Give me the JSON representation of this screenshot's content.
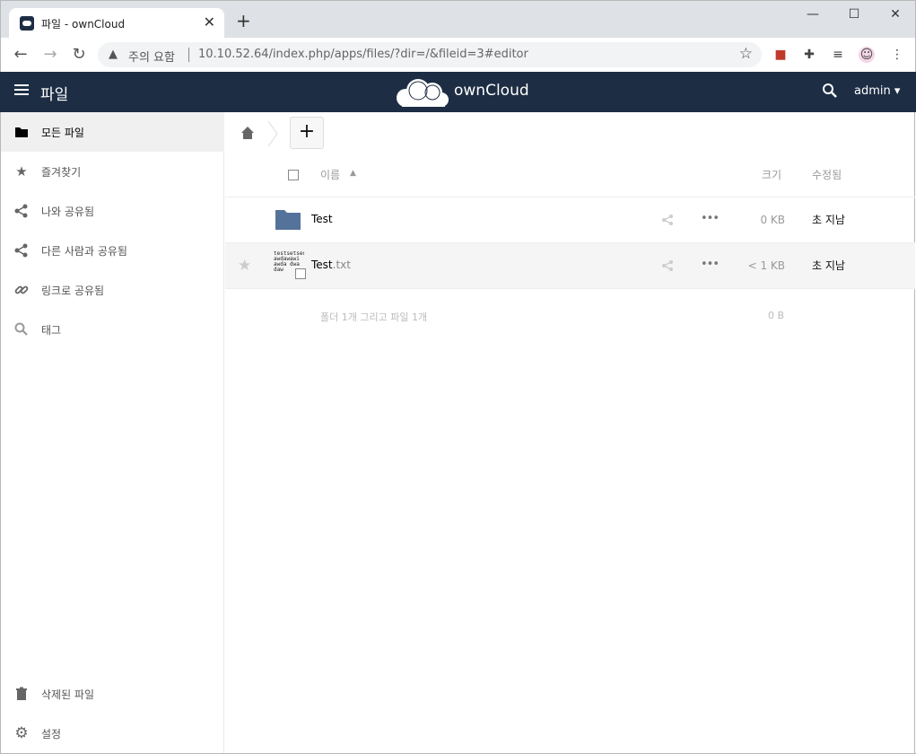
{
  "browser": {
    "tab_title": "파일 - ownCloud",
    "tab_close": "✕",
    "new_tab": "+",
    "minimize": "—",
    "maximize": "☐",
    "close": "✕",
    "security_label": "주의 요함",
    "url": "10.10.52.64/index.php/apps/files/?dir=/&fileid=3#editor"
  },
  "header": {
    "app_title": "파일",
    "brand": "ownCloud",
    "user": "admin ▾"
  },
  "sidebar": {
    "items": [
      {
        "label": "모든 파일",
        "icon": "folder-icon"
      },
      {
        "label": "즐겨찾기",
        "icon": "star-icon"
      },
      {
        "label": "나와 공유됨",
        "icon": "share-icon"
      },
      {
        "label": "다른 사람과 공유됨",
        "icon": "share-icon"
      },
      {
        "label": "링크로 공유됨",
        "icon": "link-icon"
      },
      {
        "label": "태그",
        "icon": "search-icon"
      }
    ],
    "bottom": [
      {
        "label": "삭제된 파일",
        "icon": "trash-icon"
      },
      {
        "label": "설정",
        "icon": "gear-icon"
      }
    ]
  },
  "main": {
    "add_label": "+",
    "columns": {
      "name": "이름",
      "size": "크기",
      "modified": "수정됨"
    },
    "files": [
      {
        "name": "Test",
        "ext": "",
        "size": "0 KB",
        "modified": "초 지남",
        "type": "folder"
      },
      {
        "name": "Test",
        "ext": ".txt",
        "size": "< 1 KB",
        "modified": "초 지남",
        "type": "text",
        "preview": "testsetsed awdawawi awda dwa daw"
      }
    ],
    "summary": "폴더 1개 그리고 파일 1개",
    "summary_size": "0 B"
  },
  "colors": {
    "header_bg": "#1d2d44",
    "folder": "#55739a"
  }
}
